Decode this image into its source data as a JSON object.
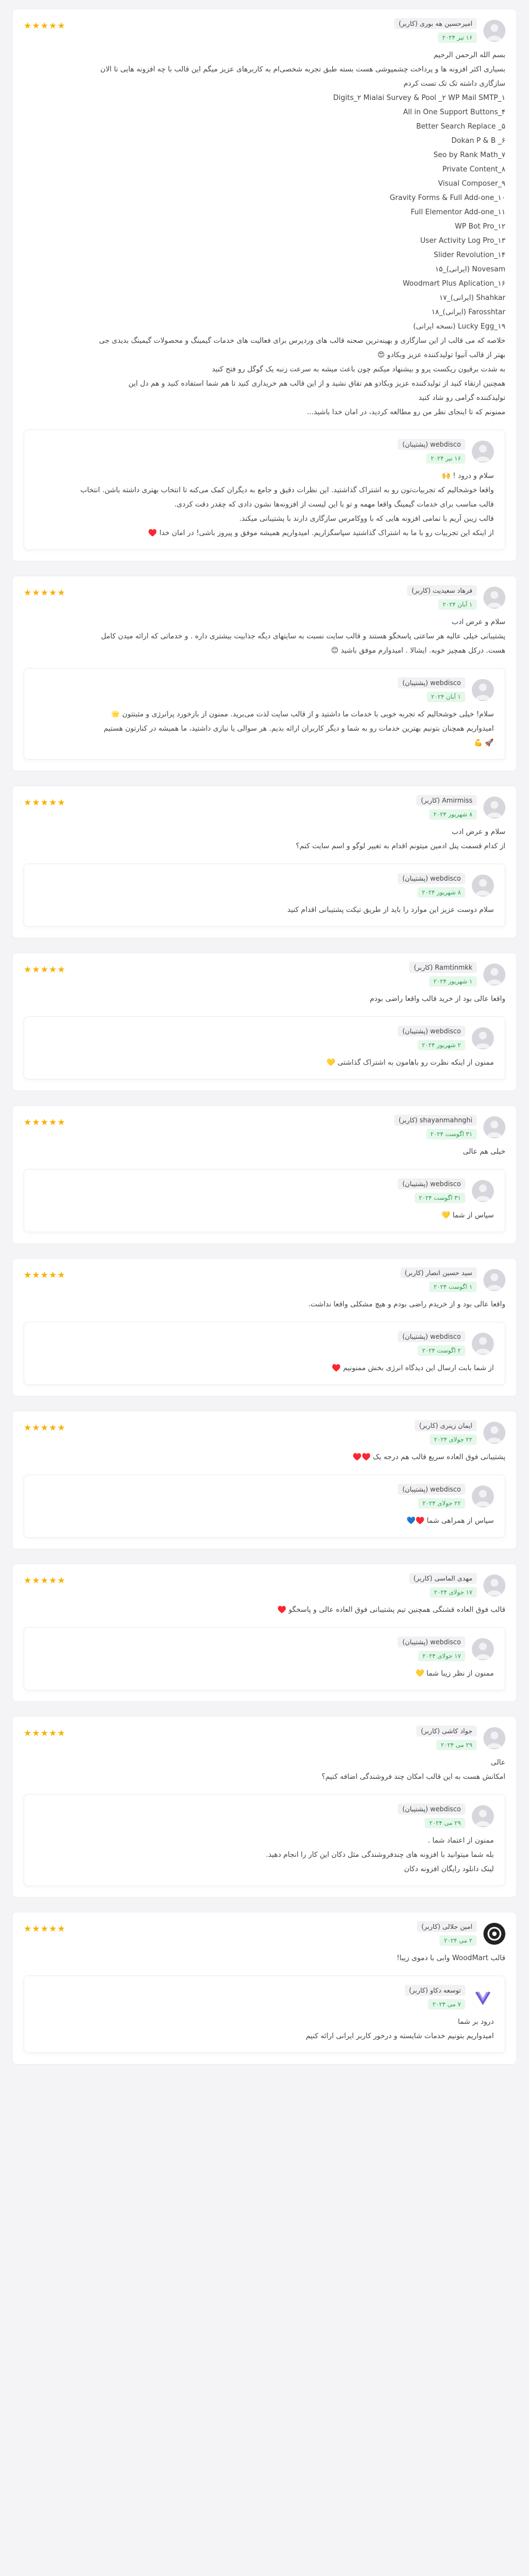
{
  "star_glyphs": "★★★★★",
  "reviews": [
    {
      "name": "امیرحسین هه بوری (کاربر)",
      "date": "۱۶ تیر ۲۰۲۴",
      "stars": "★★★★★",
      "lines": [
        "بسم الله الرحمن الرحیم",
        "بسیاری اکثر افزونه ها و پرداخت چشمپوشی هست بسته طبق تجربه شخصی‌ام به کاربرهای عزیز میگم این قالب با چه افزونه هایی تا الان",
        "سازگاری داشته تک تک تست کردم",
        "Digits_۲ Mialai Survey & Pool _۲ WP Mail SMTP_۱",
        "All in One Support Buttons_۴",
        "Better Search Replace _۵",
        "Dokan P & B _۶",
        "Seo by Rank Math_۷",
        "Private Content_۸",
        "Visual Composer_۹",
        "Gravity Forms & Full Add-one_۱۰",
        "Full Elementor Add-one_۱۱",
        "WP Bot Pro_۱۲",
        "User Activity Log Pro_۱۳",
        "Slider Revolution_۱۴",
        "Novesam (ایرانی)_۱۵",
        "Woodmart Plus Aplication_۱۶",
        "Shahkar (ایرانی)_۱۷",
        "Farosshtar (ایرانی)_۱۸",
        "Lucky Egg_۱۹ (نسخه ایرانی)",
        "خلاصه که می قالب از این سازگاری و بهینه‌ترین صحنه قالب های وردپرس برای فعالیت های خدمات گیمینگ و محصولات گیمینگ بدیدی جی",
        "بهتر از قالب آنیوا تولیدکننده عزیز وبکادو 😍",
        "به شدت برقیون ریکست پرو و بیشنهاد میکنم چون باعث میشه به سرعت زنبه یک گوگل رو فتح کنید",
        "همچنین ارتقاء کنید از تولیدکننده عزیز وبکادو هم تقاق نشید و از این قالب هم خریداری کنید تا هم شما استفاده کنید و هم دل این",
        "تولیدکننده گرامی رو شاد کنید",
        "ممنونم که تا اینجای نظر من رو مطالعه کردید، در امان خدا باشید..."
      ],
      "replies": [
        {
          "name": "webdisco (پشتیبان)",
          "date": "۱۶ تیر ۲۰۲۴",
          "lines": [
            "سلام و درود ! 🙌",
            "واقعا خوشحالیم که تجربیات‌تون رو به اشتراک گذاشتید. این نظرات دقیق و جامع به دیگران کمک می‌کنه تا انتخاب بهتری داشته باشن. انتخاب",
            "قالب مناسب برای خدمات گیمینگ واقعا مهمه و تو با این لیست از افزونه‌ها نشون دادی که چقدر دقت کردی.",
            "قالب زیبن آریم با تمامی افزونه هایی که با ووکامرس سازگاری دارند با پشتیبانی میکند.",
            "از اینکه این تجربیات رو با ما به اشتراک گذاشتید سپاسگزاریم. امیدواریم همیشه موفق و پیروز باشی! در امان خدا ♥️"
          ]
        }
      ]
    },
    {
      "name": "فرهاد سعیدیت (کاربر)",
      "date": "۱ آبان ۲۰۲۴",
      "stars": "★★★★★",
      "lines": [
        "سلام و عرض ادب",
        "پشتیبانی خیلی عالیه هر ساعتی پاسخگو هستند و قالب سایت نسبت به سایتهای دیگه جذابیت بیشتری داره . و خدماتی که ارائه میدن کامل",
        "هست. درکل همچیز خوبه. ایشالا . امیدوارم موفق باشید 😊"
      ],
      "replies": [
        {
          "name": "webdisco (پشتیبان)",
          "date": "۱ آبان ۲۰۲۴",
          "lines": [
            "سلام! خیلی خوشحالیم که تجربه خوبی با خدمات ما داشتید و از قالب سایت لذت می‌برید. ممنون از بازخورد پرانرژی و مثبتتون 🌟",
            "امیدواریم همچنان بتونیم بهترین خدمات رو به شما و دیگر کاربران ارائه بدیم. هر سوالی یا نیازی داشتید، ما همیشه در کنارتون هستیم",
            "🚀 💪"
          ]
        }
      ]
    },
    {
      "name": "Amirmiss (کاربر)",
      "date": "۸ شهریور ۲۰۲۴",
      "stars": "★★★★★",
      "lines": [
        "سلام و عرض ادب",
        "از کدام قسمت پنل ادمین میتونم اقدام به تغییر لوگو و اسم سایت کنم؟"
      ],
      "replies": [
        {
          "name": "webdisco (پشتیبان)",
          "date": "۸ شهریور ۲۰۲۴",
          "lines": [
            "سلام دوست عزیز این موارد را باید از طریق تیکت پشتیبانی اقدام کنید"
          ]
        }
      ]
    },
    {
      "name": "Ramtinmkk (کاربر)",
      "date": "۱ شهریور ۲۰۲۴",
      "stars": "★★★★★",
      "lines": [
        "واقعا عالی بود از خرید قالب واقعا راضی بودم"
      ],
      "replies": [
        {
          "name": "webdisco (پشتیبان)",
          "date": "۲ شهریور ۲۰۲۴",
          "lines": [
            "ممنون از اینکه نظرت رو باهامون به اشتراک گذاشتی 💛"
          ]
        }
      ]
    },
    {
      "name": "shayanmahnghi (کاربر)",
      "date": "۳۱ اگوست ۲۰۲۴",
      "stars": "★★★★★",
      "lines": [
        "خیلی هم عالی"
      ],
      "replies": [
        {
          "name": "webdisco (پشتیبان)",
          "date": "۳۱ اگوست ۲۰۲۴",
          "lines": [
            "سپاس از شما 💛"
          ]
        }
      ]
    },
    {
      "name": "سید حسین انصار (کاربر)",
      "date": "۱ اگوست ۲۰۲۴",
      "stars": "★★★★★",
      "lines": [
        "واقعا عالی بود و از خریدم راضی بودم و هیچ مشکلی واقعا نداشت."
      ],
      "replies": [
        {
          "name": "webdisco (پشتیبان)",
          "date": "۲ اگوست ۲۰۲۴",
          "lines": [
            "از شما بابت ارسال این دیدگاه انرژی بخش ممنونیم ♥️"
          ]
        }
      ]
    },
    {
      "name": "ایمان زینری (کاربر)",
      "date": "۲۲ جولای ۲۰۲۴",
      "stars": "★★★★★",
      "lines": [
        "پشتیبانی فوق العاده سریع قالب هم درجه یک ♥️♥️"
      ],
      "replies": [
        {
          "name": "webdisco (پشتیبان)",
          "date": "۲۲ جولای ۲۰۲۴",
          "lines": [
            "سپاس از همراهی شما ♥️💙"
          ]
        }
      ]
    },
    {
      "name": "مهدی الماسی (کاربر)",
      "date": "۱۷ جولای ۲۰۲۴",
      "stars": "★★★★★",
      "lines": [
        "قالب فوق العاده قشنگی همچنین تیم پشتیبانی فوق العاده عالی و پاسخگو ♥️"
      ],
      "replies": [
        {
          "name": "webdisco (پشتیبان)",
          "date": "۱۷ جولای ۲۰۲۴",
          "lines": [
            "ممنون از نظر زیبا شما 💛"
          ]
        }
      ]
    },
    {
      "name": "جواد کاشی (کاربر)",
      "date": "۲۹ می ۲۰۲۴",
      "stars": "★★★★★",
      "lines": [
        "عالی",
        "امکانش هست به این قالب امکان چند فروشندگی اضافه کنیم؟"
      ],
      "replies": [
        {
          "name": "webdisco (پشتیبان)",
          "date": "۲۹ می ۲۰۲۴",
          "lines": [
            "ممنون از اعتماد شما .",
            "بله شما میتوانید با افزونه های چندفروشندگی مثل دکان این کار را انجام دهید.",
            "لینک دانلود رایگان افزونه دکان"
          ]
        }
      ]
    },
    {
      "name": "امین جلالی (کاربر)",
      "date": "۲ می ۲۰۲۴",
      "stars": "★★★★★",
      "lines": [
        "قالب WoodMart وابی با دموی زیبا!"
      ],
      "replies": [
        {
          "name": "توسعه دکاو (کاربر)",
          "date": "۷ می ۲۰۲۴",
          "lines": [
            "درود بر شما",
            "امیدواریم بتونیم خدمات شایسته و درخور کاربر ایرانی ارائه کنیم"
          ]
        }
      ]
    }
  ]
}
